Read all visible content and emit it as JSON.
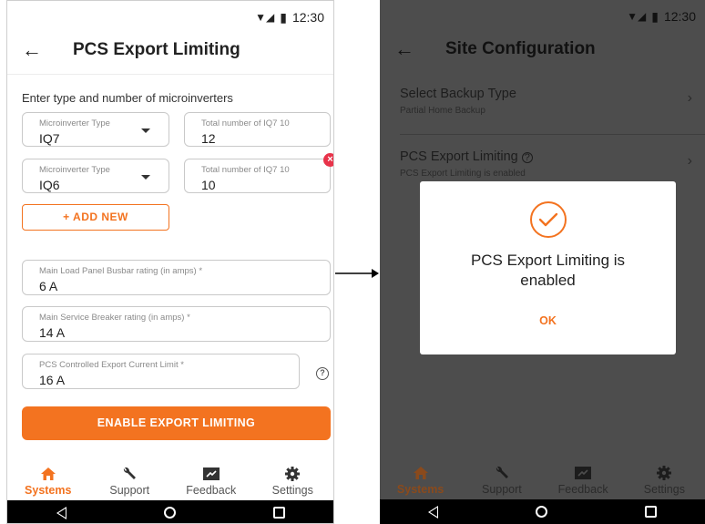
{
  "statusbar": {
    "time": "12:30"
  },
  "left": {
    "title": "PCS Export Limiting",
    "section_label": "Enter type and number of microinverters",
    "rows": [
      {
        "type_label": "Microinverter Type",
        "type_value": "IQ7",
        "count_label": "Total number of IQ7 10",
        "count_value": "12"
      },
      {
        "type_label": "Microinverter Type",
        "type_value": "IQ6",
        "count_label": "Total number of IQ7 10",
        "count_value": "10"
      }
    ],
    "add_new": "+ ADD NEW",
    "busbar": {
      "label": "Main Load Panel Busbar rating (in amps) *",
      "value": "6 A"
    },
    "breaker": {
      "label": "Main Service Breaker rating (in amps) *",
      "value": "14 A"
    },
    "export_limit": {
      "label": "PCS Controlled Export Current Limit *",
      "value": "16 A"
    },
    "primary_button": "ENABLE EXPORT LIMITING"
  },
  "bottom_nav": [
    {
      "label": "Systems",
      "icon": "home-icon",
      "active": true
    },
    {
      "label": "Support",
      "icon": "wrench-icon",
      "active": false
    },
    {
      "label": "Feedback",
      "icon": "feedback-icon",
      "active": false
    },
    {
      "label": "Settings",
      "icon": "gear-icon",
      "active": false
    }
  ],
  "right": {
    "title": "Site Configuration",
    "items": [
      {
        "title": "Select Backup Type",
        "subtitle": "Partial Home Backup"
      },
      {
        "title": "PCS Export Limiting",
        "subtitle": "PCS Export Limiting is enabled"
      }
    ],
    "dialog": {
      "message": "PCS Export Limiting is enabled",
      "ok": "OK"
    }
  },
  "colors": {
    "accent": "#f37320",
    "error": "#e8334a",
    "overlay": "#4d4d4d"
  }
}
